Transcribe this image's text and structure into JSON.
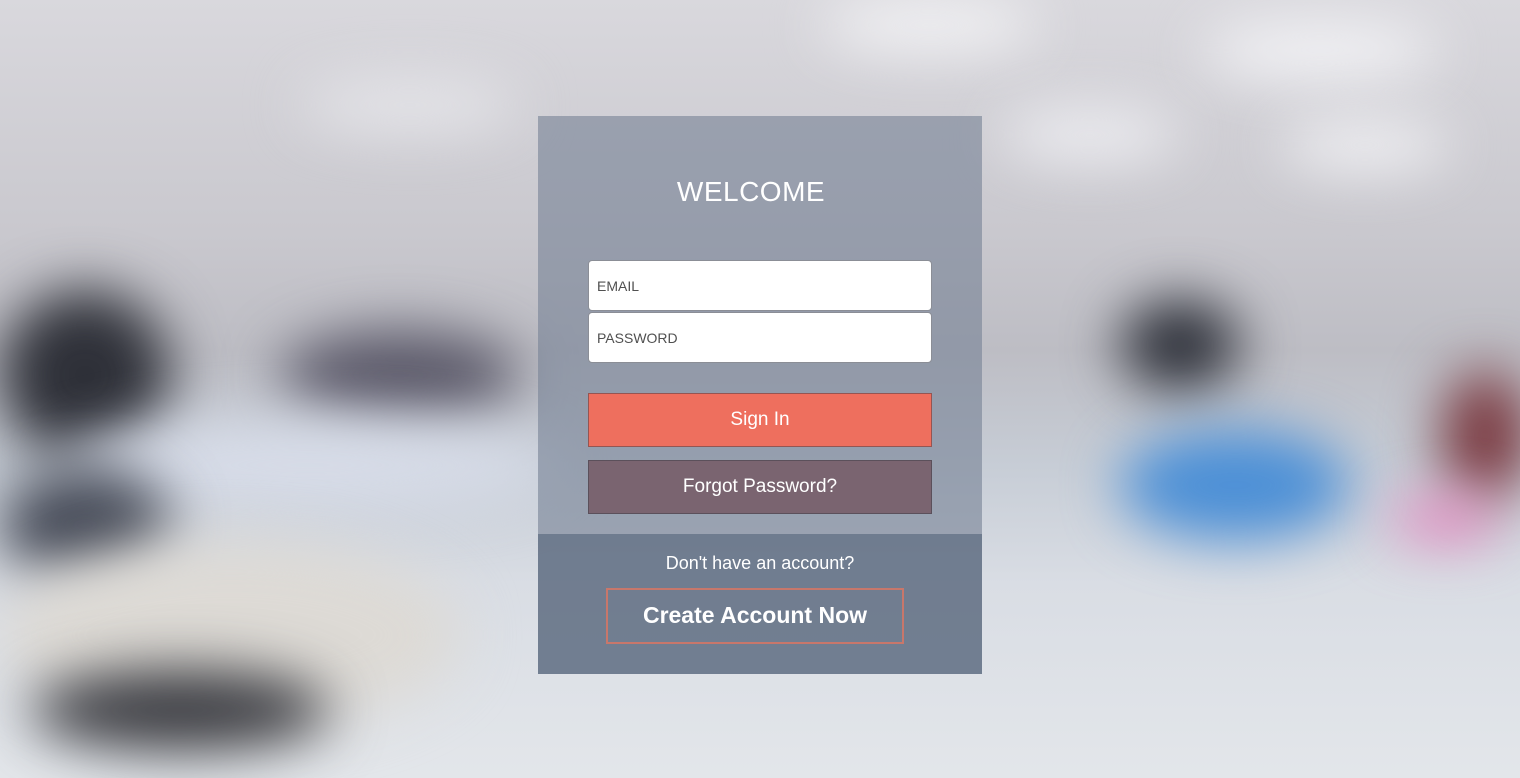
{
  "login": {
    "title": "WELCOME",
    "email_placeholder": "EMAIL",
    "password_placeholder": "PASSWORD",
    "signin_label": "Sign In",
    "forgot_label": "Forgot Password?",
    "no_account_text": "Don't have an account?",
    "create_label": "Create Account Now"
  },
  "colors": {
    "signin_button": "#ee6f5e",
    "forgot_button": "#7a6470",
    "create_border": "#c8776b",
    "card_overlay": "#78829a"
  }
}
